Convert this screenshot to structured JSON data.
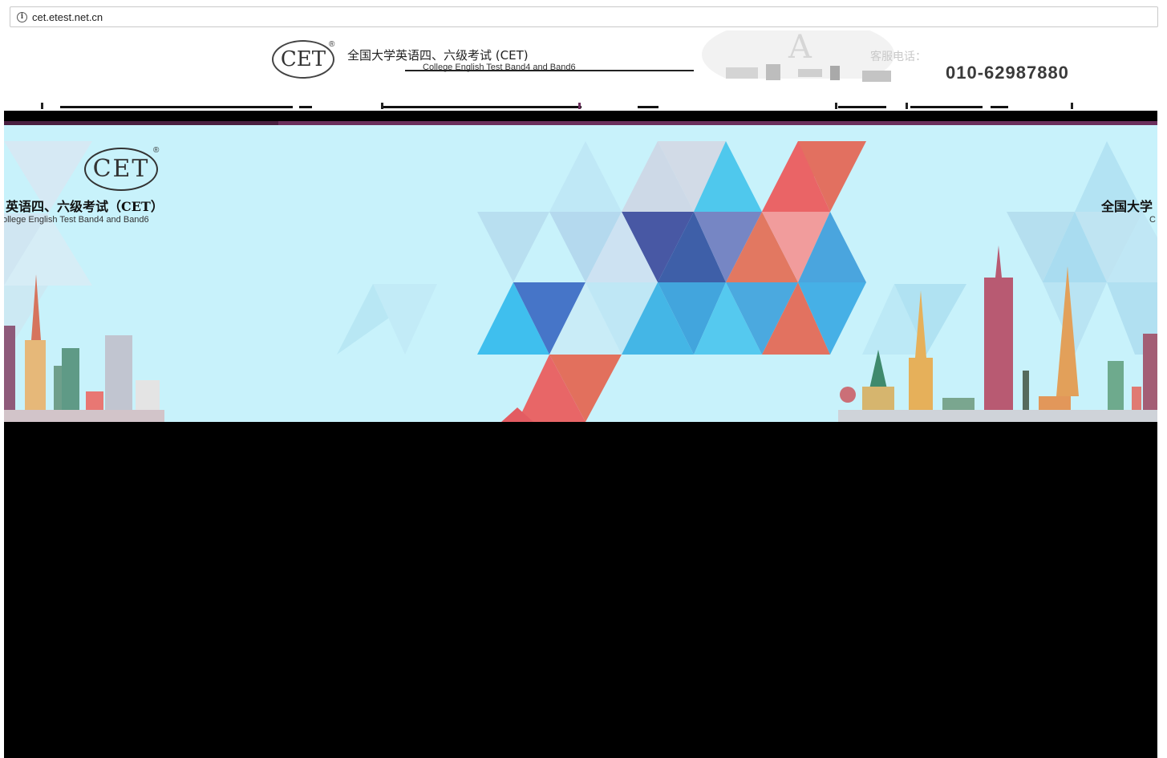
{
  "browser": {
    "url": "cet.etest.net.cn",
    "info_icon": "info-icon"
  },
  "header": {
    "logo_text": "CET",
    "logo_reg": "®",
    "title_cn": "全国大学英语四、六级考试 (CET)",
    "title_en": "College English Test Band4 and Band6",
    "phone_label": "客服电话：",
    "phone_number": "010-62987880"
  },
  "banner": {
    "logo_text": "CET",
    "logo_reg": "®",
    "title_cn": "英语四、六级考试（CET）",
    "title_en": "ollege English Test Band4 and Band6",
    "title_cn_right": "全国大学",
    "title_en_right": "C"
  },
  "colors": {
    "banner_bg": "#c8f2fb",
    "accent_purple": "#6b2f5c",
    "phone_text": "#3a3a3a"
  }
}
